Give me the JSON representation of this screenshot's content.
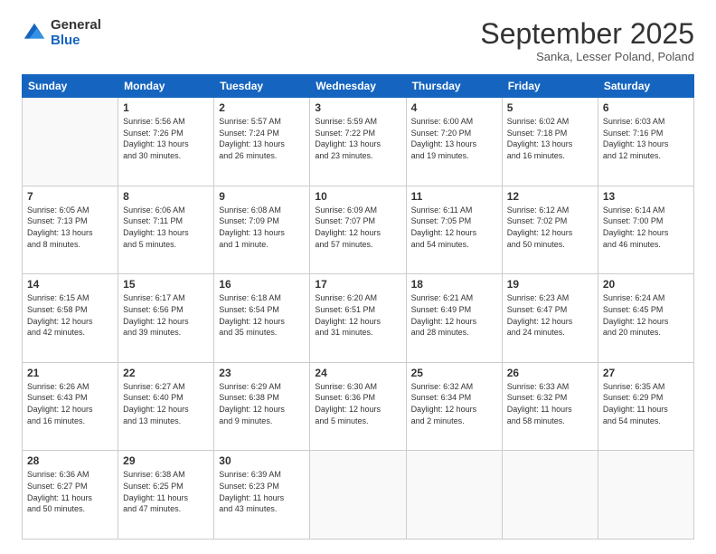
{
  "header": {
    "logo_general": "General",
    "logo_blue": "Blue",
    "month_title": "September 2025",
    "subtitle": "Sanka, Lesser Poland, Poland"
  },
  "days_of_week": [
    "Sunday",
    "Monday",
    "Tuesday",
    "Wednesday",
    "Thursday",
    "Friday",
    "Saturday"
  ],
  "weeks": [
    [
      {
        "day": "",
        "content": ""
      },
      {
        "day": "1",
        "content": "Sunrise: 5:56 AM\nSunset: 7:26 PM\nDaylight: 13 hours\nand 30 minutes."
      },
      {
        "day": "2",
        "content": "Sunrise: 5:57 AM\nSunset: 7:24 PM\nDaylight: 13 hours\nand 26 minutes."
      },
      {
        "day": "3",
        "content": "Sunrise: 5:59 AM\nSunset: 7:22 PM\nDaylight: 13 hours\nand 23 minutes."
      },
      {
        "day": "4",
        "content": "Sunrise: 6:00 AM\nSunset: 7:20 PM\nDaylight: 13 hours\nand 19 minutes."
      },
      {
        "day": "5",
        "content": "Sunrise: 6:02 AM\nSunset: 7:18 PM\nDaylight: 13 hours\nand 16 minutes."
      },
      {
        "day": "6",
        "content": "Sunrise: 6:03 AM\nSunset: 7:16 PM\nDaylight: 13 hours\nand 12 minutes."
      }
    ],
    [
      {
        "day": "7",
        "content": "Sunrise: 6:05 AM\nSunset: 7:13 PM\nDaylight: 13 hours\nand 8 minutes."
      },
      {
        "day": "8",
        "content": "Sunrise: 6:06 AM\nSunset: 7:11 PM\nDaylight: 13 hours\nand 5 minutes."
      },
      {
        "day": "9",
        "content": "Sunrise: 6:08 AM\nSunset: 7:09 PM\nDaylight: 13 hours\nand 1 minute."
      },
      {
        "day": "10",
        "content": "Sunrise: 6:09 AM\nSunset: 7:07 PM\nDaylight: 12 hours\nand 57 minutes."
      },
      {
        "day": "11",
        "content": "Sunrise: 6:11 AM\nSunset: 7:05 PM\nDaylight: 12 hours\nand 54 minutes."
      },
      {
        "day": "12",
        "content": "Sunrise: 6:12 AM\nSunset: 7:02 PM\nDaylight: 12 hours\nand 50 minutes."
      },
      {
        "day": "13",
        "content": "Sunrise: 6:14 AM\nSunset: 7:00 PM\nDaylight: 12 hours\nand 46 minutes."
      }
    ],
    [
      {
        "day": "14",
        "content": "Sunrise: 6:15 AM\nSunset: 6:58 PM\nDaylight: 12 hours\nand 42 minutes."
      },
      {
        "day": "15",
        "content": "Sunrise: 6:17 AM\nSunset: 6:56 PM\nDaylight: 12 hours\nand 39 minutes."
      },
      {
        "day": "16",
        "content": "Sunrise: 6:18 AM\nSunset: 6:54 PM\nDaylight: 12 hours\nand 35 minutes."
      },
      {
        "day": "17",
        "content": "Sunrise: 6:20 AM\nSunset: 6:51 PM\nDaylight: 12 hours\nand 31 minutes."
      },
      {
        "day": "18",
        "content": "Sunrise: 6:21 AM\nSunset: 6:49 PM\nDaylight: 12 hours\nand 28 minutes."
      },
      {
        "day": "19",
        "content": "Sunrise: 6:23 AM\nSunset: 6:47 PM\nDaylight: 12 hours\nand 24 minutes."
      },
      {
        "day": "20",
        "content": "Sunrise: 6:24 AM\nSunset: 6:45 PM\nDaylight: 12 hours\nand 20 minutes."
      }
    ],
    [
      {
        "day": "21",
        "content": "Sunrise: 6:26 AM\nSunset: 6:43 PM\nDaylight: 12 hours\nand 16 minutes."
      },
      {
        "day": "22",
        "content": "Sunrise: 6:27 AM\nSunset: 6:40 PM\nDaylight: 12 hours\nand 13 minutes."
      },
      {
        "day": "23",
        "content": "Sunrise: 6:29 AM\nSunset: 6:38 PM\nDaylight: 12 hours\nand 9 minutes."
      },
      {
        "day": "24",
        "content": "Sunrise: 6:30 AM\nSunset: 6:36 PM\nDaylight: 12 hours\nand 5 minutes."
      },
      {
        "day": "25",
        "content": "Sunrise: 6:32 AM\nSunset: 6:34 PM\nDaylight: 12 hours\nand 2 minutes."
      },
      {
        "day": "26",
        "content": "Sunrise: 6:33 AM\nSunset: 6:32 PM\nDaylight: 11 hours\nand 58 minutes."
      },
      {
        "day": "27",
        "content": "Sunrise: 6:35 AM\nSunset: 6:29 PM\nDaylight: 11 hours\nand 54 minutes."
      }
    ],
    [
      {
        "day": "28",
        "content": "Sunrise: 6:36 AM\nSunset: 6:27 PM\nDaylight: 11 hours\nand 50 minutes."
      },
      {
        "day": "29",
        "content": "Sunrise: 6:38 AM\nSunset: 6:25 PM\nDaylight: 11 hours\nand 47 minutes."
      },
      {
        "day": "30",
        "content": "Sunrise: 6:39 AM\nSunset: 6:23 PM\nDaylight: 11 hours\nand 43 minutes."
      },
      {
        "day": "",
        "content": ""
      },
      {
        "day": "",
        "content": ""
      },
      {
        "day": "",
        "content": ""
      },
      {
        "day": "",
        "content": ""
      }
    ]
  ]
}
